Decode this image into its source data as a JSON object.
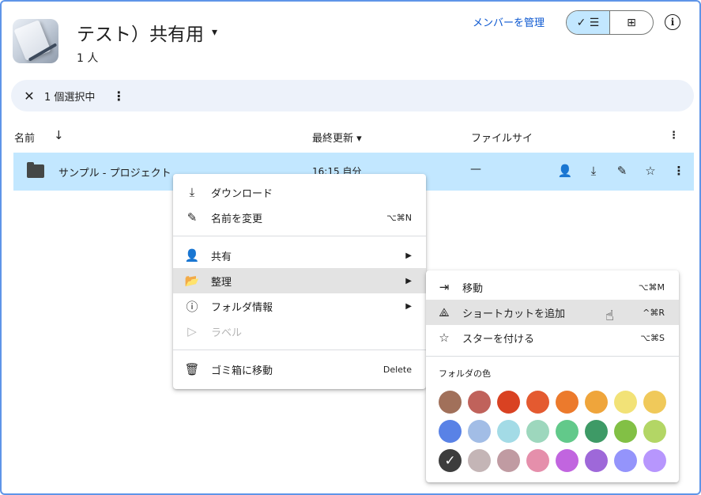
{
  "header": {
    "title": "テスト）共有用",
    "title_caret": "▾",
    "members": "1 人",
    "manage_members": "メンバーを管理",
    "view_list_icon": "✓ ☰",
    "view_grid_icon": "⊞",
    "info_icon": "i"
  },
  "selection_bar": {
    "close_icon": "✕",
    "count_label": "1 個選択中",
    "more_icon": "⋮"
  },
  "columns": {
    "name": "名前",
    "name_sort_icon": "↓",
    "modified": "最終更新",
    "modified_caret": "▾",
    "size": "ファイルサイ",
    "more_icon": "⋮"
  },
  "row": {
    "name": "サンプル - プロジェクト",
    "modified": "16:15 自分",
    "size": "—",
    "actions": {
      "share_icon": "👤",
      "download_icon": "⤓",
      "rename_icon": "✎",
      "star_icon": "☆",
      "more_icon": "⋮"
    }
  },
  "context_menu": {
    "items": [
      {
        "icon": "⤓",
        "label": "ダウンロード",
        "shortcut": ""
      },
      {
        "icon": "✎",
        "label": "名前を変更",
        "shortcut": "⌥⌘N"
      },
      {
        "icon": "👤",
        "label": "共有",
        "arrow": "▶"
      },
      {
        "icon": "📂",
        "label": "整理",
        "arrow": "▶"
      },
      {
        "icon": "ⓘ",
        "label": "フォルダ情報",
        "arrow": "▶"
      },
      {
        "icon": "▷",
        "label": "ラベル"
      },
      {
        "icon": "🗑",
        "label": "ゴミ箱に移動",
        "shortcut": "Delete"
      }
    ]
  },
  "submenu": {
    "items": [
      {
        "icon": "⇥",
        "label": "移動",
        "shortcut": "⌥⌘M"
      },
      {
        "icon": "⟁",
        "label": "ショートカットを追加",
        "shortcut": "^⌘R"
      },
      {
        "icon": "☆",
        "label": "スターを付ける",
        "shortcut": "⌥⌘S"
      }
    ],
    "color_title": "フォルダの色",
    "colors": [
      "#a1705a",
      "#c0625b",
      "#d94222",
      "#e45a30",
      "#ec7a2c",
      "#efa53b",
      "#f2e277",
      "#f0c95a",
      "#5982e6",
      "#a2bde6",
      "#a3dbe6",
      "#9dd7bd",
      "#62c98a",
      "#3e9a66",
      "#82c045",
      "#b3d665",
      "#3d3d3d",
      "#c4b5b6",
      "#c09ba2",
      "#e58fab",
      "#c165df",
      "#9e68d9",
      "#9494fb",
      "#b796fd"
    ],
    "selected_mark": "✓",
    "cursor_icon": "☝"
  }
}
